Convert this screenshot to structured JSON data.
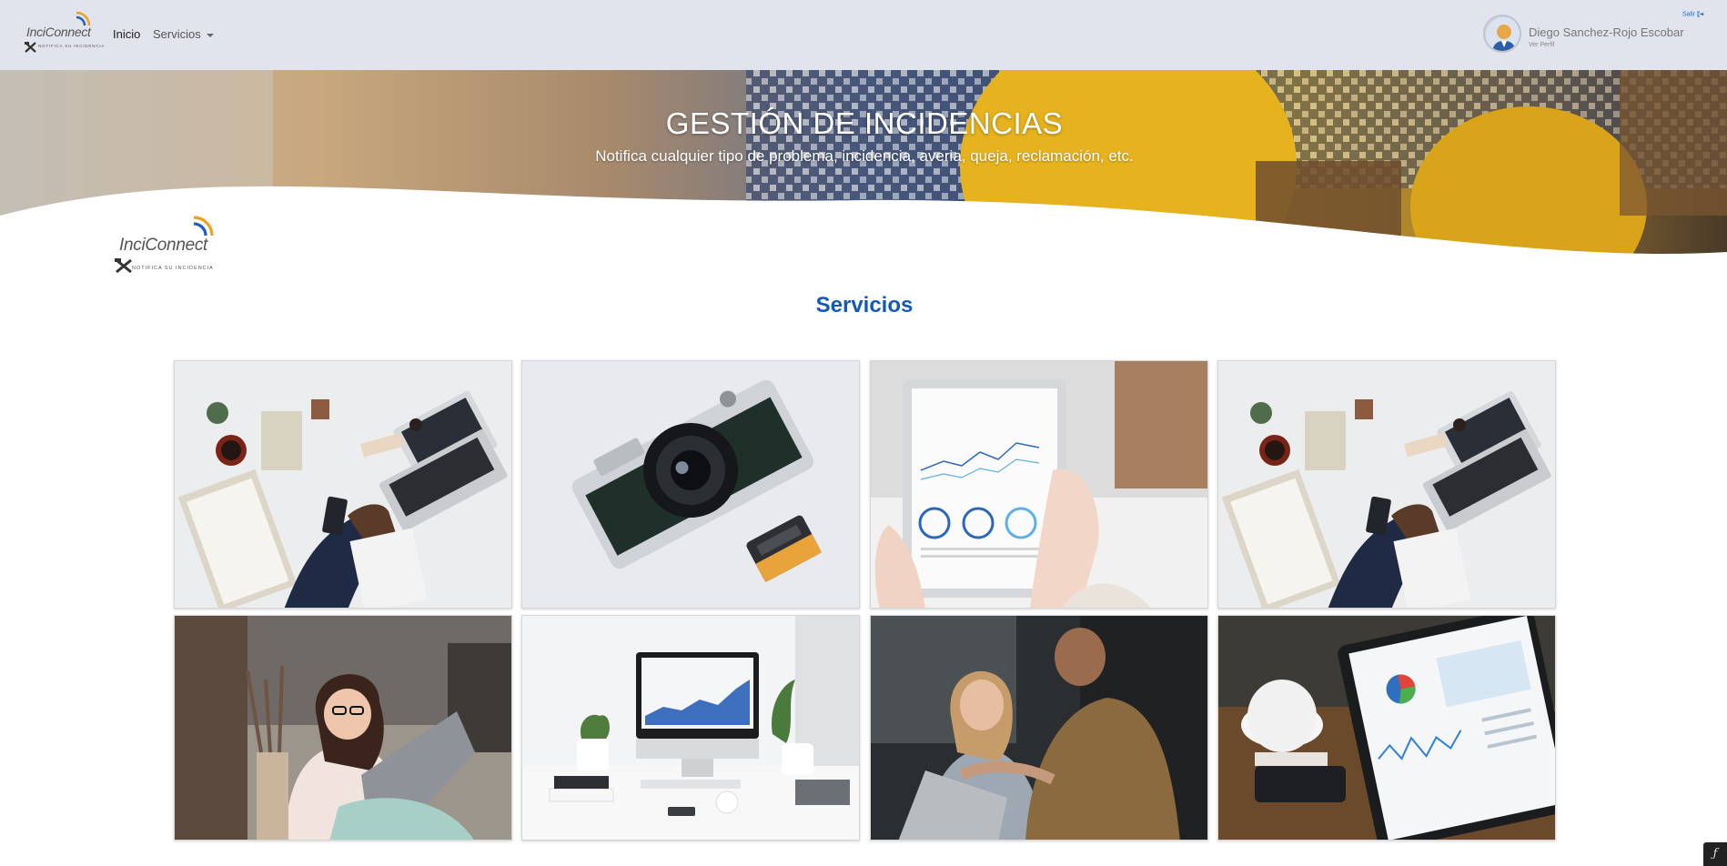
{
  "navbar": {
    "brand_name": "InciConnect",
    "brand_tagline": "NOTIFICA SU INCIDENCIA",
    "links": [
      {
        "label": "Inicio"
      },
      {
        "label": "Servicios"
      }
    ],
    "user": {
      "name": "Diego Sanchez-Rojo Escobar",
      "profile_link": "Ver Perfil",
      "logout_label": "Salir"
    }
  },
  "hero": {
    "title": "GESTIÓN DE INCIDENCIAS",
    "subtitle": "Notifica cualquier tipo de problema, incidencia, averia, queja, reclamación, etc."
  },
  "logo": {
    "brand_name": "InciConnect",
    "brand_tagline": "NOTIFICA SU INCIDENCIA"
  },
  "services": {
    "title": "Servicios",
    "tiles": [
      {
        "image": "business-desk-laptop-phone"
      },
      {
        "image": "film-camera"
      },
      {
        "image": "tablet-finance-report"
      },
      {
        "image": "business-desk-laptop-phone"
      },
      {
        "image": "woman-laptop-glasses"
      },
      {
        "image": "imac-desk-plants"
      },
      {
        "image": "people-meeting-laptop"
      },
      {
        "image": "tablet-analytics-coffee"
      }
    ]
  },
  "colors": {
    "navbar_bg": "#e1e4ec",
    "accent_blue": "#1559b7",
    "logo_orange": "#f0a020",
    "logo_blue": "#1f5fbf"
  },
  "icons": {
    "logout": "sign-out-icon",
    "caret": "caret-down-icon",
    "avatar": "user-avatar-icon",
    "symfony": "symfony-toolbar-icon"
  }
}
